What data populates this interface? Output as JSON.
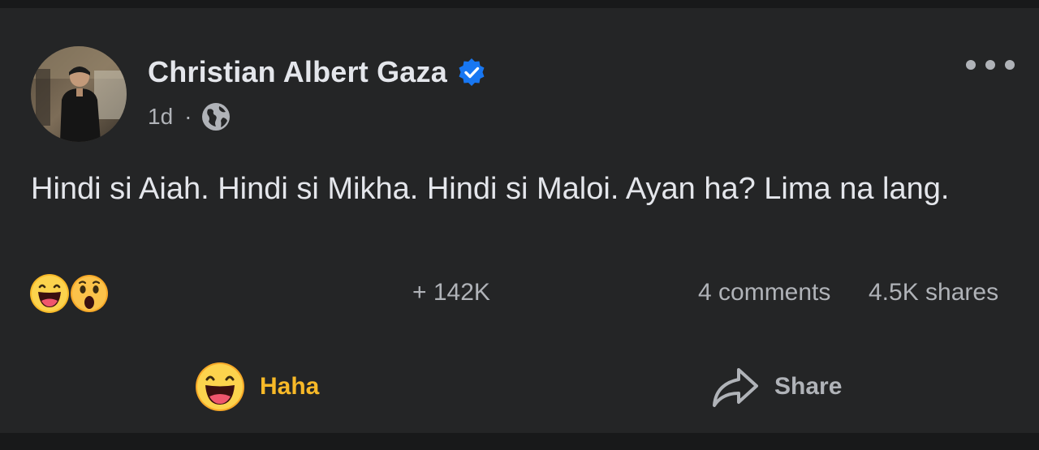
{
  "post": {
    "author_name": "Christian Albert Gaza",
    "verified_icon": "verified-badge-icon",
    "time": "1d",
    "separator": "·",
    "audience_icon": "globe-icon",
    "text": "Hindi si Aiah. Hindi si Mikha. Hindi si Maloi. Ayan ha? Lima na lang.",
    "reactions": {
      "icons": [
        "haha-emoji-icon",
        "wow-emoji-icon"
      ],
      "count": "+ 142K"
    },
    "comments": "4 comments",
    "shares": "4.5K shares"
  },
  "actions": {
    "haha_label": "Haha",
    "share_label": "Share"
  },
  "colors": {
    "background": "#18191a",
    "card": "#242526",
    "primary_text": "#e4e6eb",
    "secondary_text": "#b0b3b8",
    "verified_blue": "#1877f2",
    "haha_yellow": "#f7b928"
  }
}
